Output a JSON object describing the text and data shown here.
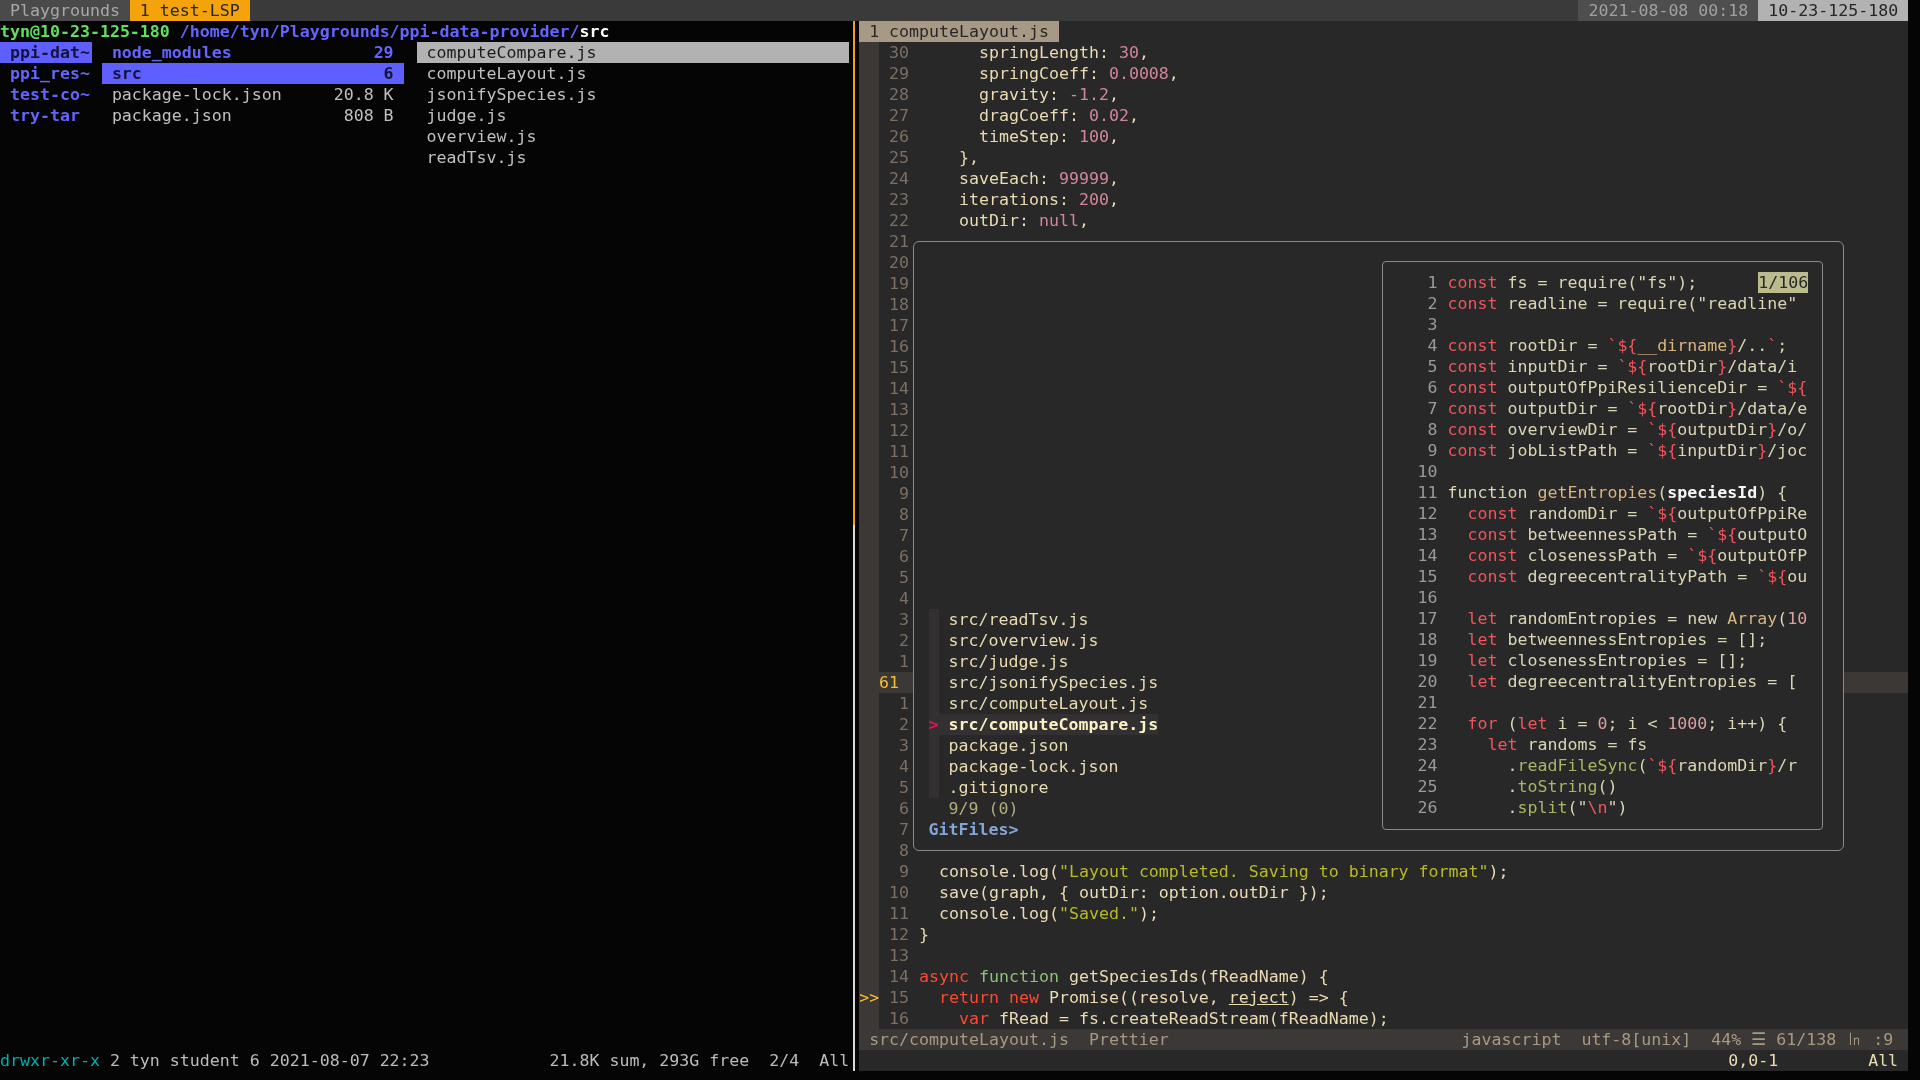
{
  "tmux": {
    "session": "Playgrounds",
    "windows": [
      {
        "label": "1 test-LSP",
        "selected": true
      }
    ],
    "clock": "2021-08-08 00:18",
    "host": "10-23-125-180"
  },
  "ranger": {
    "prompt": {
      "user_host": "tyn@10-23-125-180",
      "path": "/home/tyn/Playgrounds/ppi-data-provider/",
      "current": "src"
    },
    "parent_column": [
      {
        "name": "ppi-dat~",
        "selected": true
      },
      {
        "name": "ppi_res~",
        "selected": false
      },
      {
        "name": "test-co~",
        "selected": false
      },
      {
        "name": "try-tar",
        "selected": false
      }
    ],
    "current_column": [
      {
        "name": "node_modules",
        "size": "29",
        "kind": "directory",
        "selected": false
      },
      {
        "name": "src",
        "size": "6",
        "kind": "directory",
        "selected": true
      },
      {
        "name": "package-lock.json",
        "size": "20.8 K",
        "kind": "file",
        "selected": false
      },
      {
        "name": "package.json",
        "size": "808 B",
        "kind": "file",
        "selected": false
      }
    ],
    "preview_column": [
      {
        "name": "computeCompare.js",
        "selected": true
      },
      {
        "name": "computeLayout.js",
        "selected": false
      },
      {
        "name": "jsonifySpecies.js",
        "selected": false
      },
      {
        "name": "judge.js",
        "selected": false
      },
      {
        "name": "overview.js",
        "selected": false
      },
      {
        "name": "readTsv.js",
        "selected": false
      }
    ],
    "status": {
      "permissions": "drwxr-xr-x",
      "info": "2 tyn student 6 2021-08-07 22:23",
      "summary": "21.8K sum, 293G free",
      "position": "2/4",
      "scroll": "All"
    }
  },
  "vim": {
    "tabs": [
      {
        "label": "1 computeLayout.js",
        "selected": true
      }
    ],
    "lines": [
      {
        "number": "30",
        "current": false,
        "code": [
          {
            "text": "      springLength: ",
            "kind": "plain"
          },
          {
            "text": "30",
            "kind": "number"
          },
          {
            "text": ",",
            "kind": "plain"
          }
        ]
      },
      {
        "number": "29",
        "current": false,
        "code": [
          {
            "text": "      springCoeff: ",
            "kind": "plain"
          },
          {
            "text": "0.0008",
            "kind": "number"
          },
          {
            "text": ",",
            "kind": "plain"
          }
        ]
      },
      {
        "number": "28",
        "current": false,
        "code": [
          {
            "text": "      gravity: ",
            "kind": "plain"
          },
          {
            "text": "-1.2",
            "kind": "number"
          },
          {
            "text": ",",
            "kind": "plain"
          }
        ]
      },
      {
        "number": "27",
        "current": false,
        "code": [
          {
            "text": "      dragCoeff: ",
            "kind": "plain"
          },
          {
            "text": "0.02",
            "kind": "number"
          },
          {
            "text": ",",
            "kind": "plain"
          }
        ]
      },
      {
        "number": "26",
        "current": false,
        "code": [
          {
            "text": "      timeStep: ",
            "kind": "plain"
          },
          {
            "text": "100",
            "kind": "number"
          },
          {
            "text": ",",
            "kind": "plain"
          }
        ]
      },
      {
        "number": "25",
        "current": false,
        "code": [
          {
            "text": "    },",
            "kind": "plain"
          }
        ]
      },
      {
        "number": "24",
        "current": false,
        "code": [
          {
            "text": "    saveEach: ",
            "kind": "plain"
          },
          {
            "text": "99999",
            "kind": "number"
          },
          {
            "text": ",",
            "kind": "plain"
          }
        ]
      },
      {
        "number": "23",
        "current": false,
        "code": [
          {
            "text": "    iterations: ",
            "kind": "plain"
          },
          {
            "text": "200",
            "kind": "number"
          },
          {
            "text": ",",
            "kind": "plain"
          }
        ]
      },
      {
        "number": "22",
        "current": false,
        "code": [
          {
            "text": "    outDir: ",
            "kind": "plain"
          },
          {
            "text": "null",
            "kind": "number"
          },
          {
            "text": ",",
            "kind": "plain"
          }
        ]
      },
      {
        "number": "21",
        "current": false
      },
      {
        "number": "20",
        "current": false
      },
      {
        "number": "19",
        "current": false
      },
      {
        "number": "18",
        "current": false
      },
      {
        "number": "17",
        "current": false
      },
      {
        "number": "16",
        "current": false
      },
      {
        "number": "15",
        "current": false
      },
      {
        "number": "14",
        "current": false
      },
      {
        "number": "13",
        "current": false
      },
      {
        "number": "12",
        "current": false
      },
      {
        "number": "11",
        "current": false
      },
      {
        "number": "10",
        "current": false
      },
      {
        "number": "9",
        "current": false
      },
      {
        "number": "8",
        "current": false
      },
      {
        "number": "7",
        "current": false
      },
      {
        "number": "6",
        "current": false
      },
      {
        "number": "5",
        "current": false
      },
      {
        "number": "4",
        "current": false
      },
      {
        "number": "3",
        "current": false
      },
      {
        "number": "2",
        "current": false
      },
      {
        "number": "1",
        "current": false
      },
      {
        "number": "61",
        "current": true
      },
      {
        "number": "1",
        "current": false
      },
      {
        "number": "2",
        "current": false
      },
      {
        "number": "3",
        "current": false
      },
      {
        "number": "4",
        "current": false
      },
      {
        "number": "5",
        "current": false
      },
      {
        "number": "6",
        "current": false
      },
      {
        "number": "7",
        "current": false
      },
      {
        "number": "8",
        "current": false
      },
      {
        "number": "9",
        "current": false,
        "code": [
          {
            "text": "  console.log(",
            "kind": "plain"
          },
          {
            "text": "\"Layout completed. Saving to binary format\"",
            "kind": "string"
          },
          {
            "text": ");",
            "kind": "plain"
          }
        ]
      },
      {
        "number": "10",
        "current": false,
        "code": [
          {
            "text": "  save(graph, { outDir: option.outDir });",
            "kind": "plain"
          }
        ]
      },
      {
        "number": "11",
        "current": false,
        "code": [
          {
            "text": "  console.log(",
            "kind": "plain"
          },
          {
            "text": "\"Saved.\"",
            "kind": "string"
          },
          {
            "text": ");",
            "kind": "plain"
          }
        ]
      },
      {
        "number": "12",
        "current": false,
        "code": [
          {
            "text": "}",
            "kind": "plain"
          }
        ]
      },
      {
        "number": "13",
        "current": false
      },
      {
        "number": "14",
        "current": false,
        "code": [
          {
            "text": "async",
            "kind": "keyword"
          },
          {
            "text": " function",
            "kind": "storage"
          },
          {
            "text": " getSpeciesIds(fReadName) {",
            "kind": "plain"
          }
        ]
      },
      {
        "number": "15",
        "current": false,
        "sign": ">>",
        "code": [
          {
            "text": "  return new",
            "kind": "keyword"
          },
          {
            "text": " Promise((resolve, ",
            "kind": "plain"
          },
          {
            "text": "reject",
            "kind": "underline"
          },
          {
            "text": ") => {",
            "kind": "plain"
          }
        ]
      },
      {
        "number": "16",
        "current": false,
        "code": [
          {
            "text": "    var",
            "kind": "keyword"
          },
          {
            "text": " fRead = fs.createReadStream(fReadName);",
            "kind": "plain"
          }
        ]
      }
    ],
    "finder": {
      "pointer": ">",
      "items": [
        {
          "path": "src/readTsv.js",
          "selected": false
        },
        {
          "path": "src/overview.js",
          "selected": false
        },
        {
          "path": "src/judge.js",
          "selected": false
        },
        {
          "path": "src/jsonifySpecies.js",
          "selected": false
        },
        {
          "path": "src/computeLayout.js",
          "selected": false
        },
        {
          "path": "src/computeCompare.js",
          "selected": true
        },
        {
          "path": "package.json",
          "selected": false
        },
        {
          "path": "package-lock.json",
          "selected": false
        },
        {
          "path": ".gitignore",
          "selected": false
        }
      ],
      "info": "9/9 (0)",
      "prompt": "GitFiles>",
      "preview": {
        "position": "1/106",
        "lines": [
          {
            "number": "1",
            "code": [
              {
                "text": "const",
                "kind": "keyword"
              },
              {
                "text": " fs = require(\"fs\");",
                "kind": "plain"
              }
            ]
          },
          {
            "number": "2",
            "code": [
              {
                "text": "const",
                "kind": "keyword"
              },
              {
                "text": " readline = require(\"readline\"",
                "kind": "plain"
              }
            ]
          },
          {
            "number": "3"
          },
          {
            "number": "4",
            "code": [
              {
                "text": "const",
                "kind": "keyword"
              },
              {
                "text": " rootDir = ",
                "kind": "plain"
              },
              {
                "text": "`${",
                "kind": "template"
              },
              {
                "text": "__dirname",
                "kind": "builtin"
              },
              {
                "text": "}",
                "kind": "template"
              },
              {
                "text": "/..",
                "kind": "plain"
              },
              {
                "text": "`",
                "kind": "template"
              },
              {
                "text": ";",
                "kind": "plain"
              }
            ]
          },
          {
            "number": "5",
            "code": [
              {
                "text": "const",
                "kind": "keyword"
              },
              {
                "text": " inputDir = ",
                "kind": "plain"
              },
              {
                "text": "`${",
                "kind": "template"
              },
              {
                "text": "rootDir",
                "kind": "plain"
              },
              {
                "text": "}",
                "kind": "template"
              },
              {
                "text": "/data/i",
                "kind": "plain"
              }
            ]
          },
          {
            "number": "6",
            "code": [
              {
                "text": "const",
                "kind": "keyword"
              },
              {
                "text": " outputOfPpiResilienceDir = ",
                "kind": "plain"
              },
              {
                "text": "`${",
                "kind": "template"
              }
            ]
          },
          {
            "number": "7",
            "code": [
              {
                "text": "const",
                "kind": "keyword"
              },
              {
                "text": " outputDir = ",
                "kind": "plain"
              },
              {
                "text": "`${",
                "kind": "template"
              },
              {
                "text": "rootDir",
                "kind": "plain"
              },
              {
                "text": "}",
                "kind": "template"
              },
              {
                "text": "/data/e",
                "kind": "plain"
              }
            ]
          },
          {
            "number": "8",
            "code": [
              {
                "text": "const",
                "kind": "keyword"
              },
              {
                "text": " overviewDir = ",
                "kind": "plain"
              },
              {
                "text": "`${",
                "kind": "template"
              },
              {
                "text": "outputDir",
                "kind": "plain"
              },
              {
                "text": "}",
                "kind": "template"
              },
              {
                "text": "/o/",
                "kind": "plain"
              }
            ]
          },
          {
            "number": "9",
            "code": [
              {
                "text": "const",
                "kind": "keyword"
              },
              {
                "text": " jobListPath = ",
                "kind": "plain"
              },
              {
                "text": "`${",
                "kind": "template"
              },
              {
                "text": "inputDir",
                "kind": "plain"
              },
              {
                "text": "}",
                "kind": "template"
              },
              {
                "text": "/joc",
                "kind": "plain"
              }
            ]
          },
          {
            "number": "10"
          },
          {
            "number": "11",
            "code": [
              {
                "text": "function ",
                "kind": "plain"
              },
              {
                "text": "getEntropies",
                "kind": "function"
              },
              {
                "text": "(",
                "kind": "plain"
              },
              {
                "text": "speciesId",
                "kind": "param"
              },
              {
                "text": ") {",
                "kind": "plain"
              }
            ]
          },
          {
            "number": "12",
            "code": [
              {
                "text": "  const",
                "kind": "keyword"
              },
              {
                "text": " randomDir = ",
                "kind": "plain"
              },
              {
                "text": "`${",
                "kind": "template"
              },
              {
                "text": "outputOfPpiRe",
                "kind": "plain"
              }
            ]
          },
          {
            "number": "13",
            "code": [
              {
                "text": "  const",
                "kind": "keyword"
              },
              {
                "text": " betweennessPath = ",
                "kind": "plain"
              },
              {
                "text": "`${",
                "kind": "template"
              },
              {
                "text": "outputO",
                "kind": "plain"
              }
            ]
          },
          {
            "number": "14",
            "code": [
              {
                "text": "  const",
                "kind": "keyword"
              },
              {
                "text": " closenessPath = ",
                "kind": "plain"
              },
              {
                "text": "`${",
                "kind": "template"
              },
              {
                "text": "outputOfP",
                "kind": "plain"
              }
            ]
          },
          {
            "number": "15",
            "code": [
              {
                "text": "  const",
                "kind": "keyword"
              },
              {
                "text": " degreecentralityPath = ",
                "kind": "plain"
              },
              {
                "text": "`${",
                "kind": "template"
              },
              {
                "text": "ou",
                "kind": "plain"
              }
            ]
          },
          {
            "number": "16"
          },
          {
            "number": "17",
            "code": [
              {
                "text": "  let",
                "kind": "keyword"
              },
              {
                "text": " randomEntropies = new ",
                "kind": "plain"
              },
              {
                "text": "Array",
                "kind": "builtin"
              },
              {
                "text": "(",
                "kind": "plain"
              },
              {
                "text": "10",
                "kind": "number"
              }
            ]
          },
          {
            "number": "18",
            "code": [
              {
                "text": "  let",
                "kind": "keyword"
              },
              {
                "text": " betweennessEntropies = [];",
                "kind": "plain"
              }
            ]
          },
          {
            "number": "19",
            "code": [
              {
                "text": "  let",
                "kind": "keyword"
              },
              {
                "text": " closenessEntropies = [];",
                "kind": "plain"
              }
            ]
          },
          {
            "number": "20",
            "code": [
              {
                "text": "  let",
                "kind": "keyword"
              },
              {
                "text": " degreecentralityEntropies = [",
                "kind": "plain"
              }
            ]
          },
          {
            "number": "21"
          },
          {
            "number": "22",
            "code": [
              {
                "text": "  for",
                "kind": "keyword"
              },
              {
                "text": " (",
                "kind": "plain"
              },
              {
                "text": "let",
                "kind": "keyword"
              },
              {
                "text": " i = ",
                "kind": "plain"
              },
              {
                "text": "0",
                "kind": "number"
              },
              {
                "text": "; i < ",
                "kind": "plain"
              },
              {
                "text": "1000",
                "kind": "number"
              },
              {
                "text": "; i++) {",
                "kind": "plain"
              }
            ]
          },
          {
            "number": "23",
            "code": [
              {
                "text": "    let",
                "kind": "keyword"
              },
              {
                "text": " randoms = fs",
                "kind": "plain"
              }
            ]
          },
          {
            "number": "24",
            "code": [
              {
                "text": "      .",
                "kind": "plain"
              },
              {
                "text": "readFileSync",
                "kind": "method"
              },
              {
                "text": "(",
                "kind": "plain"
              },
              {
                "text": "`${",
                "kind": "template"
              },
              {
                "text": "randomDir",
                "kind": "plain"
              },
              {
                "text": "}",
                "kind": "template"
              },
              {
                "text": "/r",
                "kind": "plain"
              }
            ]
          },
          {
            "number": "25",
            "code": [
              {
                "text": "      .",
                "kind": "plain"
              },
              {
                "text": "toString",
                "kind": "method"
              },
              {
                "text": "()",
                "kind": "plain"
              }
            ]
          },
          {
            "number": "26",
            "code": [
              {
                "text": "      .",
                "kind": "plain"
              },
              {
                "text": "split",
                "kind": "method"
              },
              {
                "text": "(\"",
                "kind": "plain"
              },
              {
                "text": "\\n",
                "kind": "template"
              },
              {
                "text": "\")",
                "kind": "plain"
              }
            ]
          }
        ]
      }
    },
    "statusline": {
      "file": "src/computeLayout.js",
      "formatter": "Prettier",
      "filetype": "javascript",
      "encoding": "utf-8[unix]",
      "position": "44% ☰ 61/138 ㏑ :9"
    },
    "cmdline": {
      "ruler": "0,0-1",
      "scroll": "All"
    }
  }
}
